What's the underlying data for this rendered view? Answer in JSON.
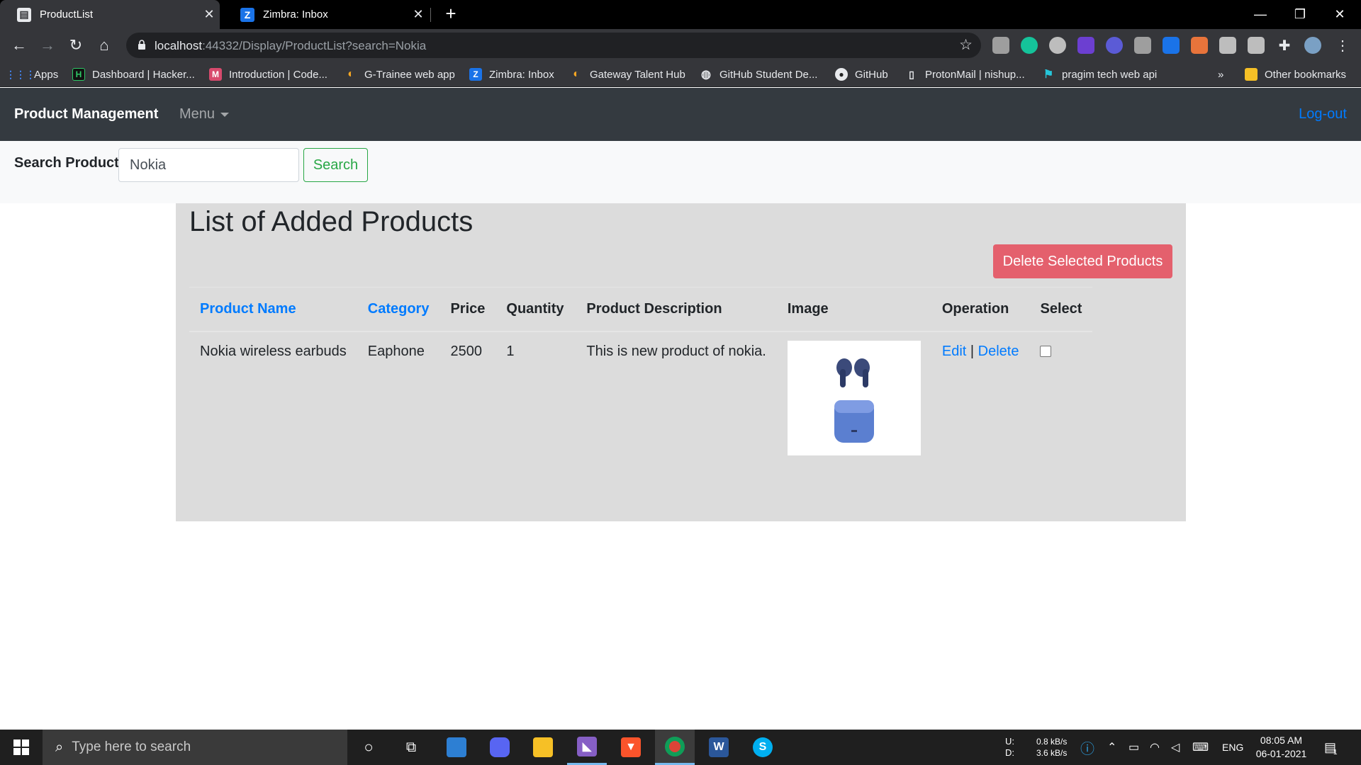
{
  "browser": {
    "tabs": [
      {
        "title": "ProductList",
        "icon": "document-icon",
        "active": true
      },
      {
        "title": "Zimbra: Inbox",
        "icon": "zimbra-icon",
        "active": false
      }
    ],
    "url_host": "localhost",
    "url_rest": ":44332/Display/ProductList?search=Nokia",
    "bookmarks": [
      {
        "label": "Apps",
        "icon": "apps-grid-icon"
      },
      {
        "label": "Dashboard | Hacker...",
        "icon": "hackerrank-icon"
      },
      {
        "label": "Introduction | Code...",
        "icon": "codechef-icon"
      },
      {
        "label": "G-Trainee web app",
        "icon": "gateway-icon"
      },
      {
        "label": "Zimbra: Inbox",
        "icon": "zimbra-icon"
      },
      {
        "label": "Gateway Talent Hub",
        "icon": "gateway-icon"
      },
      {
        "label": "GitHub Student De...",
        "icon": "globe-icon"
      },
      {
        "label": "GitHub",
        "icon": "github-icon"
      },
      {
        "label": "ProtonMail | nishup...",
        "icon": "protonmail-icon"
      },
      {
        "label": "pragim tech web api",
        "icon": "pragim-icon"
      }
    ],
    "bookmarks_overflow": "»",
    "other_bookmarks": "Other bookmarks"
  },
  "app": {
    "brand": "Product Management",
    "menu": "Menu",
    "logout": "Log-out",
    "search": {
      "label": "Search Product",
      "value": "Nokia",
      "button": "Search"
    },
    "panel": {
      "title": "List of Added Products",
      "delete_selected": "Delete Selected Products",
      "columns": [
        "Product Name",
        "Category",
        "Price",
        "Quantity",
        "Product Description",
        "Image",
        "Operation",
        "Select"
      ],
      "rows": [
        {
          "name": "Nokia wireless earbuds",
          "category": "Eaphone",
          "price": "2500",
          "quantity": "1",
          "description": "This is new product of nokia.",
          "edit": "Edit",
          "separator": "|",
          "delete": "Delete",
          "selected": false
        }
      ]
    }
  },
  "taskbar": {
    "search_placeholder": "Type here to search",
    "net_upload_label": "U:",
    "net_download_label": "D:",
    "net_upload": "0.8 kB/s",
    "net_download": "3.6 kB/s",
    "language": "ENG",
    "time": "08:05 AM",
    "date": "06-01-2021",
    "notification_count": "1"
  },
  "colors": {
    "navbar": "#343a40",
    "link": "#007bff",
    "success": "#28a745",
    "danger_light": "#e4606d",
    "panel_bg": "#dcdcdc"
  }
}
